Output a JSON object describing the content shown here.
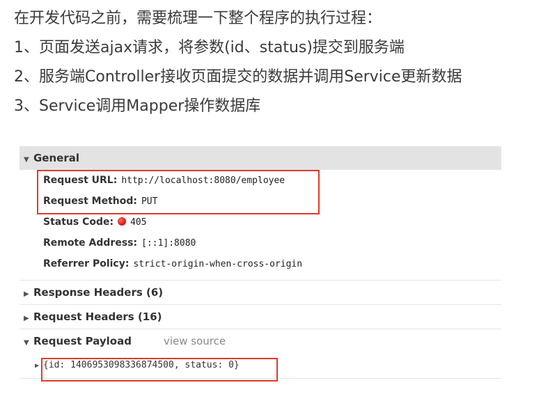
{
  "notes": [
    "在开发代码之前，需要梳理一下整个程序的执行过程：",
    "1、页面发送ajax请求，将参数(id、status)提交到服务端",
    "2、服务端Controller接收页面提交的数据并调用Service更新数据",
    "3、Service调用Mapper操作数据库"
  ],
  "general": {
    "title": "General",
    "fields": [
      {
        "key": "Request URL:",
        "value": "http://localhost:8080/employee"
      },
      {
        "key": "Request Method:",
        "value": "PUT"
      },
      {
        "key": "Status Code:",
        "value": "405"
      },
      {
        "key": "Remote Address:",
        "value": "[::1]:8080"
      },
      {
        "key": "Referrer Policy:",
        "value": "strict-origin-when-cross-origin"
      }
    ]
  },
  "response_headers": {
    "title": "Response Headers (6)"
  },
  "request_headers": {
    "title": "Request Headers (16)"
  },
  "payload": {
    "title": "Request Payload",
    "view_source": "view source",
    "body": "{id: 1406953098336874500, status: 0}"
  },
  "colors": {
    "highlight": "#e03a2a",
    "status_error": "#d4140a"
  }
}
